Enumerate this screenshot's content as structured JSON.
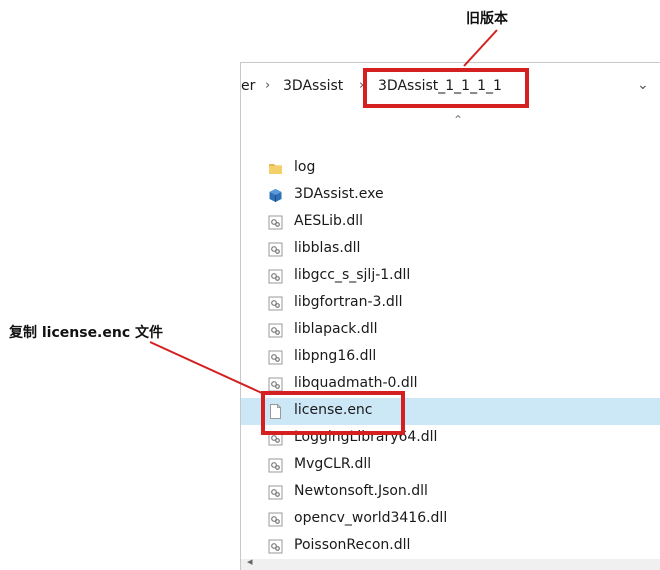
{
  "annotations": {
    "top_label": "旧版本",
    "left_label": "复制 license.enc 文件",
    "accent_color": "#d42020"
  },
  "breadcrumb": {
    "partial": "er",
    "parent": "3DAssist",
    "current": "3DAssist_1_1_1_1",
    "separator": ">",
    "dropdown": "chevron-down-icon"
  },
  "files": [
    {
      "name": "log",
      "icon": "folder-icon",
      "selected": false
    },
    {
      "name": "3DAssist.exe",
      "icon": "exe-icon",
      "selected": false
    },
    {
      "name": "AESLib.dll",
      "icon": "dll-icon",
      "selected": false
    },
    {
      "name": "libblas.dll",
      "icon": "dll-icon",
      "selected": false
    },
    {
      "name": "libgcc_s_sjlj-1.dll",
      "icon": "dll-icon",
      "selected": false
    },
    {
      "name": "libgfortran-3.dll",
      "icon": "dll-icon",
      "selected": false
    },
    {
      "name": "liblapack.dll",
      "icon": "dll-icon",
      "selected": false
    },
    {
      "name": "libpng16.dll",
      "icon": "dll-icon",
      "selected": false
    },
    {
      "name": "libquadmath-0.dll",
      "icon": "dll-icon",
      "selected": false
    },
    {
      "name": "license.enc",
      "icon": "file-icon",
      "selected": true
    },
    {
      "name": "LoggingLibrary64.dll",
      "icon": "dll-icon",
      "selected": false
    },
    {
      "name": "MvgCLR.dll",
      "icon": "dll-icon",
      "selected": false
    },
    {
      "name": "Newtonsoft.Json.dll",
      "icon": "dll-icon",
      "selected": false
    },
    {
      "name": "opencv_world3416.dll",
      "icon": "dll-icon",
      "selected": false
    },
    {
      "name": "PoissonRecon.dll",
      "icon": "dll-icon",
      "selected": false
    }
  ]
}
